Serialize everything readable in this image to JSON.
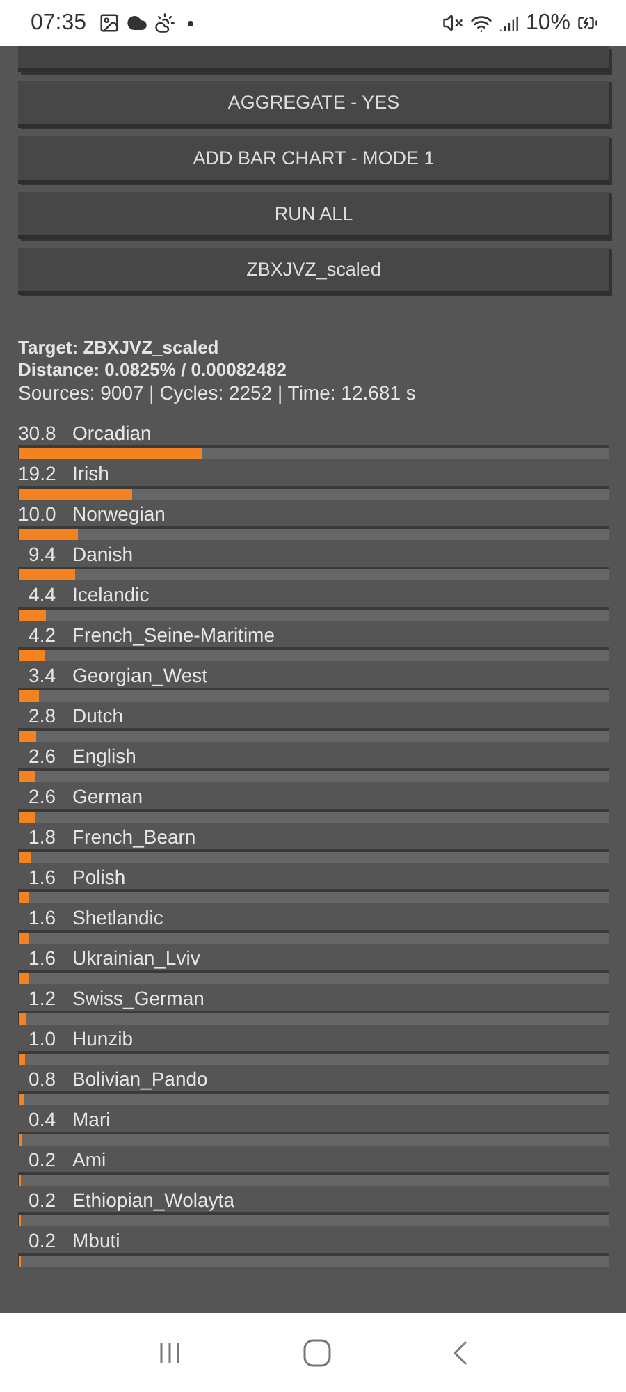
{
  "status_bar": {
    "time": "07:35",
    "battery": "10%"
  },
  "buttons": [
    {
      "label": "AGGREGATE - YES"
    },
    {
      "label": "ADD BAR CHART - MODE 1"
    },
    {
      "label": "RUN ALL"
    },
    {
      "label": "ZBXJVZ_scaled"
    }
  ],
  "summary": {
    "target": "Target: ZBXJVZ_scaled",
    "distance": "Distance: 0.0825% / 0.00082482",
    "stats": "Sources: 9007 | Cycles: 2252 | Time: 12.681 s"
  },
  "results": [
    {
      "value": "30.8",
      "name": "Orcadian",
      "level": 0.308
    },
    {
      "value": "19.2",
      "name": "Irish",
      "level": 0.192
    },
    {
      "value": "10.0",
      "name": "Norwegian",
      "level": 0.1
    },
    {
      "value": "9.4",
      "name": "Danish",
      "level": 0.094
    },
    {
      "value": "4.4",
      "name": "Icelandic",
      "level": 0.044
    },
    {
      "value": "4.2",
      "name": "French_Seine-Maritime",
      "level": 0.042
    },
    {
      "value": "3.4",
      "name": "Georgian_West",
      "level": 0.034
    },
    {
      "value": "2.8",
      "name": "Dutch",
      "level": 0.028
    },
    {
      "value": "2.6",
      "name": "English",
      "level": 0.026
    },
    {
      "value": "2.6",
      "name": "German",
      "level": 0.026
    },
    {
      "value": "1.8",
      "name": "French_Bearn",
      "level": 0.018
    },
    {
      "value": "1.6",
      "name": "Polish",
      "level": 0.016
    },
    {
      "value": "1.6",
      "name": "Shetlandic",
      "level": 0.016
    },
    {
      "value": "1.6",
      "name": "Ukrainian_Lviv",
      "level": 0.016
    },
    {
      "value": "1.2",
      "name": "Swiss_German",
      "level": 0.012
    },
    {
      "value": "1.0",
      "name": "Hunzib",
      "level": 0.01
    },
    {
      "value": "0.8",
      "name": "Bolivian_Pando",
      "level": 0.008
    },
    {
      "value": "0.4",
      "name": "Mari",
      "level": 0.004
    },
    {
      "value": "0.2",
      "name": "Ami",
      "level": 0.002
    },
    {
      "value": "0.2",
      "name": "Ethiopian_Wolayta",
      "level": 0.002
    },
    {
      "value": "0.2",
      "name": "Mbuti",
      "level": 0.002
    }
  ]
}
